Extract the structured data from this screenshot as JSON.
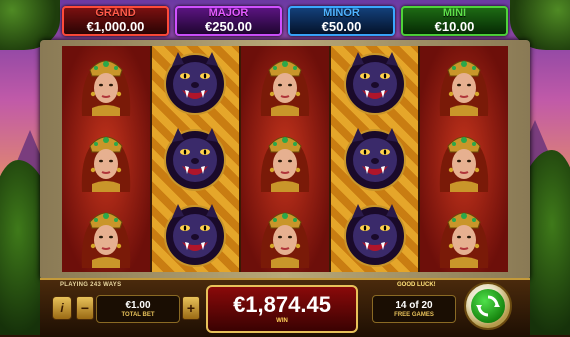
{
  "jackpots": [
    {
      "name": "GRAND",
      "value": "€1,000.00"
    },
    {
      "name": "MAJOR",
      "value": "€250.00"
    },
    {
      "name": "MINOR",
      "value": "€50.00"
    },
    {
      "name": "MINI",
      "value": "€10.00"
    }
  ],
  "reels": [
    {
      "symbols": [
        "woman",
        "woman",
        "woman"
      ]
    },
    {
      "symbols": [
        "panther",
        "panther",
        "panther"
      ]
    },
    {
      "symbols": [
        "woman",
        "woman",
        "woman"
      ]
    },
    {
      "symbols": [
        "panther",
        "panther",
        "panther"
      ]
    },
    {
      "symbols": [
        "woman",
        "woman",
        "woman"
      ]
    }
  ],
  "bottom_bar": {
    "ways_text": "PLAYING 243 WAYS",
    "info_label": "i",
    "minus_label": "−",
    "plus_label": "+",
    "bet_value": "€1.00",
    "bet_label": "TOTAL BET",
    "win_value": "€1,874.45",
    "win_label": "WIN",
    "good_luck_text": "GOOD LUCK!",
    "free_games_value": "14 of 20",
    "free_games_label": "FREE GAMES"
  },
  "icons": {
    "spin": "spin-arrows-icon",
    "info": "info-icon"
  },
  "colors": {
    "grand": "#ff5b4a",
    "major": "#e45bff",
    "minor": "#4fb3ff",
    "mini": "#5ee04a",
    "spin": "#2cb322"
  }
}
